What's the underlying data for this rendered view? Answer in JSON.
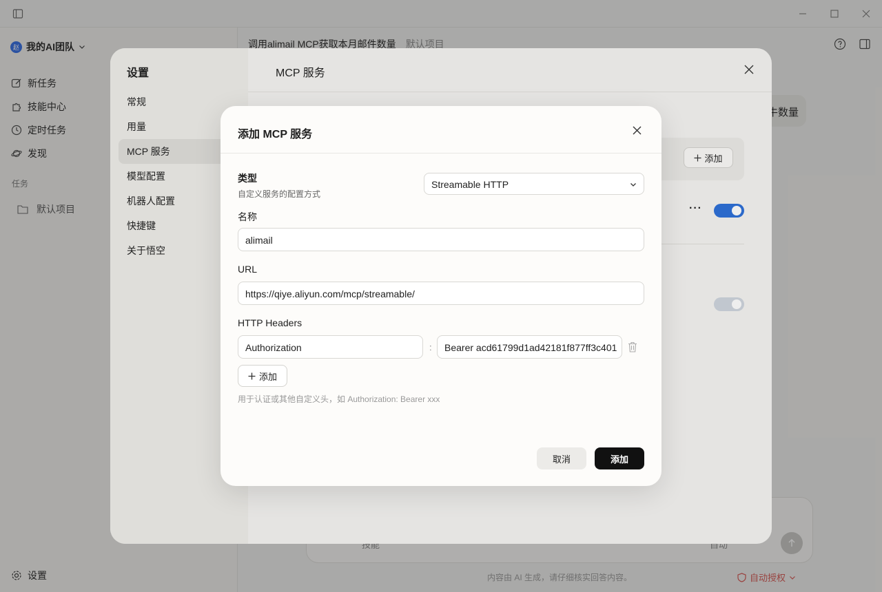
{
  "app": {
    "team_name": "我的AI团队",
    "team_avatar": "赵",
    "nav": [
      {
        "label": "新任务",
        "icon": "edit-icon"
      },
      {
        "label": "技能中心",
        "icon": "puzzle-icon"
      },
      {
        "label": "定时任务",
        "icon": "clock-icon"
      },
      {
        "label": "发现",
        "icon": "planet-icon"
      }
    ],
    "section_label": "任务",
    "project": "默认项目",
    "settings_label": "设置",
    "header_title": "调用alimail MCP获取本月邮件数量",
    "header_project": "默认项目",
    "bg_pill_text": "牛数量",
    "composer_skill": "技能",
    "composer_mode": "自动",
    "footer_note": "内容由 AI 生成，请仔细核实回答内容。",
    "auto_auth": "自动授权"
  },
  "settings": {
    "title": "设置",
    "nav": [
      "常规",
      "用量",
      "MCP 服务",
      "模型配置",
      "机器人配置",
      "快捷键",
      "关于悟空"
    ],
    "active_index": 2,
    "content_title": "MCP 服务",
    "add_label": "添加",
    "more_label": "···",
    "toggles": [
      true,
      false
    ]
  },
  "modal": {
    "title": "添加 MCP 服务",
    "type_label": "类型",
    "type_hint": "自定义服务的配置方式",
    "type_value": "Streamable HTTP",
    "name_label": "名称",
    "name_value": "alimail",
    "url_label": "URL",
    "url_value": "https://qiye.aliyun.com/mcp/streamable/",
    "headers_label": "HTTP Headers",
    "headers": [
      {
        "key": "Authorization",
        "value": "Bearer acd61799d1ad42181f877ff3c401"
      }
    ],
    "separator": ":",
    "add_header_label": "添加",
    "helper_text": "用于认证或其他自定义头，如 Authorization: Bearer xxx",
    "cancel_label": "取消",
    "submit_label": "添加"
  }
}
